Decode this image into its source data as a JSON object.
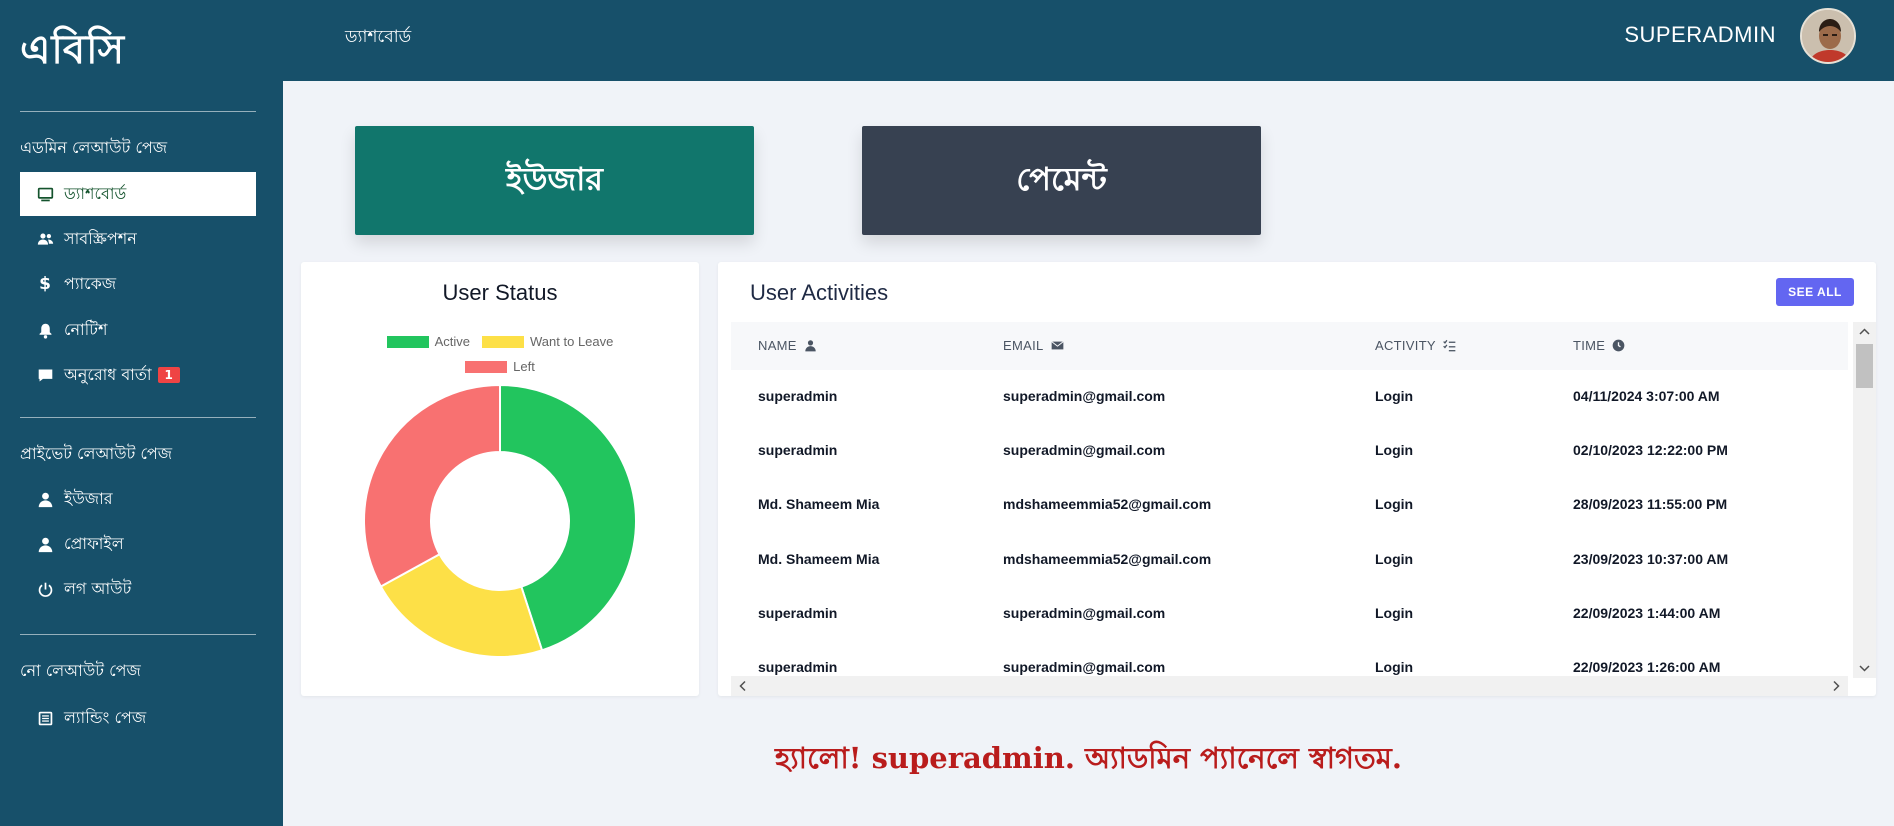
{
  "sidebar": {
    "brand": "এবিসি",
    "section1_title": "এডমিন লেআউট পেজ",
    "section1_items": [
      {
        "label": "ড্যাশবোর্ড",
        "icon": "monitor-icon"
      },
      {
        "label": "সাবস্ক্রিপশন",
        "icon": "users-icon"
      },
      {
        "label": "প্যাকেজ",
        "icon": "dollar-icon"
      },
      {
        "label": "নোটিশ",
        "icon": "bell-icon"
      },
      {
        "label": "অনুরোধ বার্তা",
        "icon": "message-icon",
        "badge": "1"
      }
    ],
    "section2_title": "প্রাইভেট লেআউট পেজ",
    "section2_items": [
      {
        "label": "ইউজার",
        "icon": "user-icon"
      },
      {
        "label": "প্রোফাইল",
        "icon": "user-icon"
      },
      {
        "label": "লগ আউট",
        "icon": "power-icon"
      }
    ],
    "section3_title": "নো লেআউট পেজ",
    "section3_items": [
      {
        "label": "ল্যান্ডিং পেজ",
        "icon": "newspaper-icon"
      }
    ]
  },
  "header": {
    "title": "ড্যাশবোর্ড",
    "username": "SUPERADMIN"
  },
  "cards": {
    "user_label": "ইউজার",
    "payment_label": "পেমেন্ট"
  },
  "user_status": {
    "title": "User Status",
    "legend": [
      {
        "label": "Active",
        "color": "#22c55e"
      },
      {
        "label": "Want to Leave",
        "color": "#fde047"
      },
      {
        "label": "Left",
        "color": "#f87171"
      }
    ]
  },
  "chart_data": {
    "type": "pie",
    "title": "User Status",
    "categories": [
      "Active",
      "Want to Leave",
      "Left"
    ],
    "values": [
      45,
      22,
      33
    ],
    "colors": [
      "#22c55e",
      "#fde047",
      "#f87171"
    ],
    "legend": "top"
  },
  "activities": {
    "title": "User Activities",
    "see_all": "SEE ALL",
    "columns": [
      "NAME",
      "EMAIL",
      "ACTIVITY",
      "TIME"
    ],
    "rows": [
      {
        "name": "superadmin",
        "email": "superadmin@gmail.com",
        "activity": "Login",
        "time": "04/11/2024 3:07:00 AM"
      },
      {
        "name": "superadmin",
        "email": "superadmin@gmail.com",
        "activity": "Login",
        "time": "02/10/2023 12:22:00 PM"
      },
      {
        "name": "Md. Shameem Mia",
        "email": "mdshameemmia52@gmail.com",
        "activity": "Login",
        "time": "28/09/2023 11:55:00 PM"
      },
      {
        "name": "Md. Shameem Mia",
        "email": "mdshameemmia52@gmail.com",
        "activity": "Login",
        "time": "23/09/2023 10:37:00 AM"
      },
      {
        "name": "superadmin",
        "email": "superadmin@gmail.com",
        "activity": "Login",
        "time": "22/09/2023 1:44:00 AM"
      },
      {
        "name": "superadmin",
        "email": "superadmin@gmail.com",
        "activity": "Login",
        "time": "22/09/2023 1:26:00 AM"
      }
    ]
  },
  "welcome": "হ্যালো! superadmin. অ্যাডমিন প্যানেলে স্বাগতম."
}
